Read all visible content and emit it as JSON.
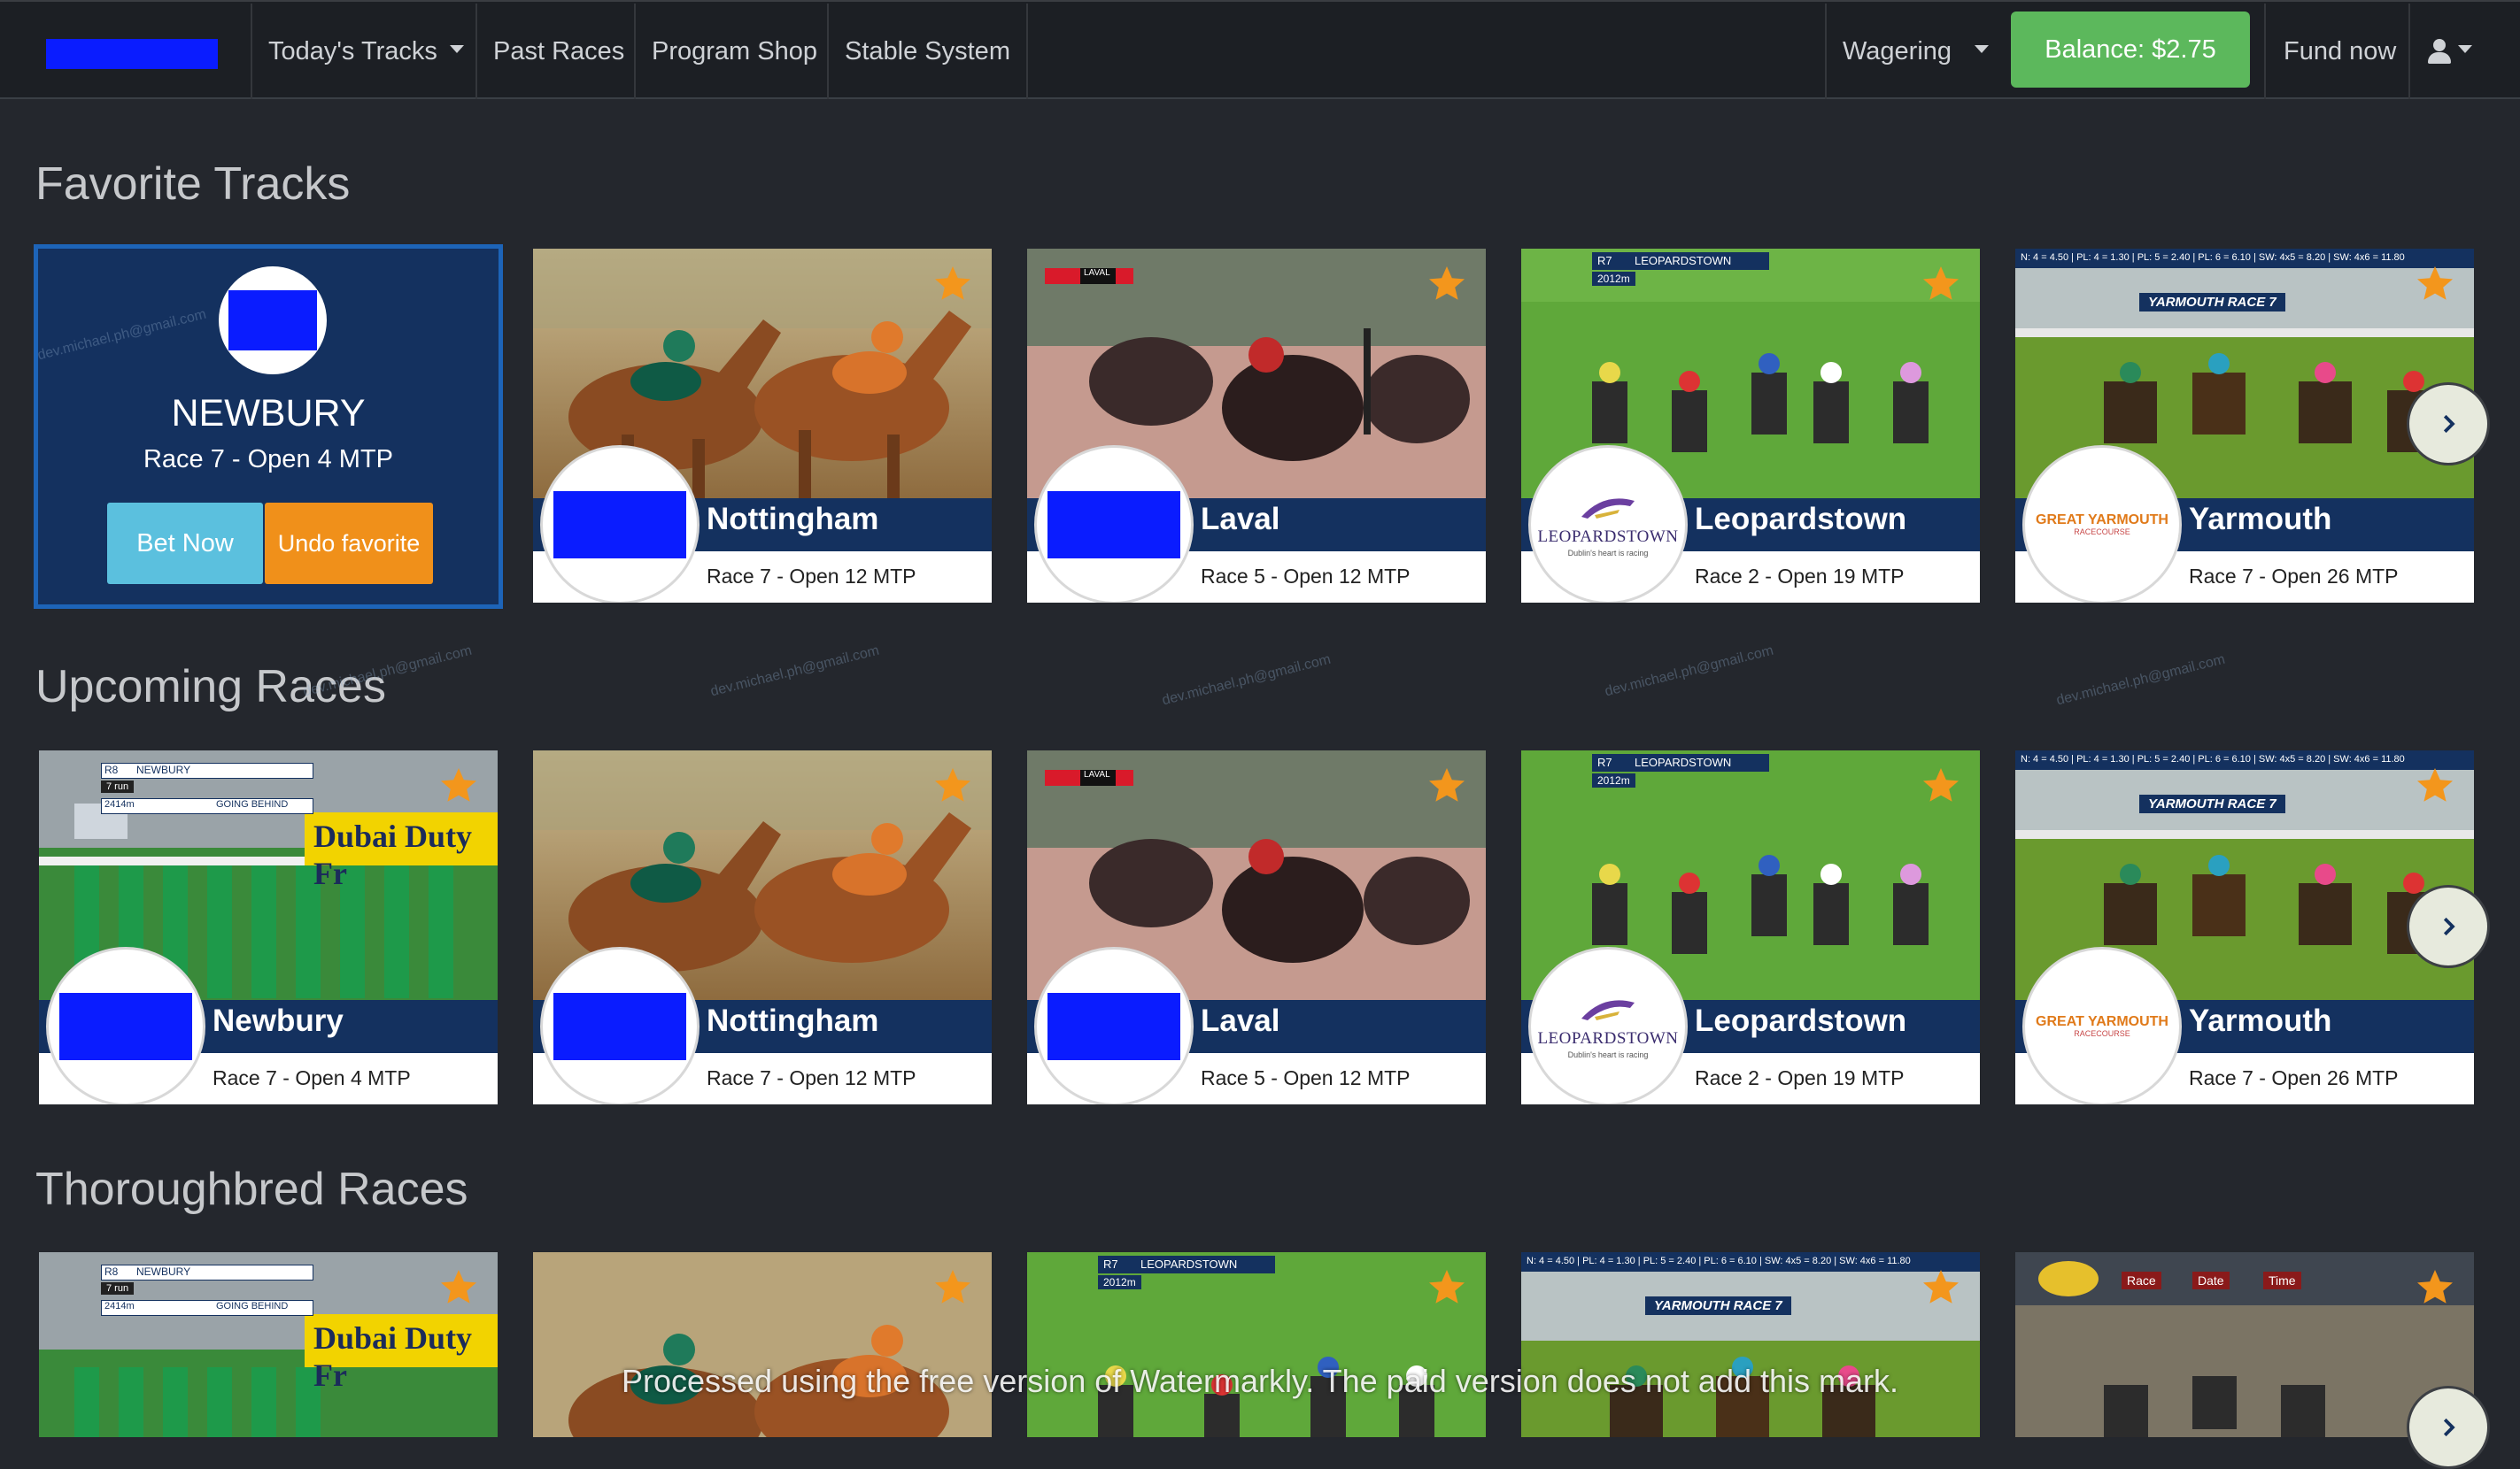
{
  "nav": {
    "items": [
      {
        "label": "Today's Tracks",
        "dropdown": true
      },
      {
        "label": "Past Races"
      },
      {
        "label": "Program Shop"
      },
      {
        "label": "Stable System"
      }
    ],
    "wagering_label": "Wagering",
    "balance_label": "Balance: $2.75",
    "fund_label": "Fund now"
  },
  "favorite_tracks": {
    "title": "Favorite Tracks",
    "featured": {
      "name": "NEWBURY",
      "race": "Race 7  - Open   4 MTP",
      "bet_label": "Bet Now",
      "undo_label": "Undo favorite"
    },
    "cards": [
      {
        "name": "Nottingham",
        "race": "Race 7 - Open 12 MTP",
        "image": "dirt-gallop",
        "logo": "blue"
      },
      {
        "name": "Laval",
        "race": "Race 5 - Open 12 MTP",
        "image": "harness",
        "logo": "blue"
      },
      {
        "name": "Leopardstown",
        "race": "Race 2 - Open 19 MTP",
        "image": "turf-field",
        "logo": "leopardstown",
        "overlay_left": "R7",
        "overlay_right": "LEOPARDSTOWN",
        "overlay_sub": "2012m"
      },
      {
        "name": "Yarmouth",
        "race": "Race 7 - Open 26 MTP",
        "image": "turf-race",
        "logo": "yarmouth",
        "overlay_top": "N: 4 = 4.50 | PL: 4 = 1.30 | PL: 5 = 2.40 | PL: 6 = 6.10 | SW: 4x5 = 8.20 | SW: 4x6 = 11.80",
        "overlay_title": "YARMOUTH RACE 7"
      }
    ]
  },
  "upcoming_races": {
    "title": "Upcoming Races",
    "cards": [
      {
        "name": "Newbury",
        "race": "Race 7 - Open 4 MTP",
        "image": "starting-gate",
        "logo": "blue",
        "overlay_left": "R8",
        "overlay_right": "NEWBURY",
        "overlay_runners": "7 run",
        "overlay_dist": "2414m",
        "overlay_going": "GOING BEHIND",
        "sponsor": "Dubai Duty Fr"
      },
      {
        "name": "Nottingham",
        "race": "Race 7 - Open 12 MTP",
        "image": "dirt-gallop",
        "logo": "blue"
      },
      {
        "name": "Laval",
        "race": "Race 5 - Open 12 MTP",
        "image": "harness",
        "logo": "blue"
      },
      {
        "name": "Leopardstown",
        "race": "Race 2 - Open 19 MTP",
        "image": "turf-field",
        "logo": "leopardstown",
        "overlay_left": "R7",
        "overlay_right": "LEOPARDSTOWN",
        "overlay_sub": "2012m"
      },
      {
        "name": "Yarmouth",
        "race": "Race 7 - Open 26 MTP",
        "image": "turf-race",
        "logo": "yarmouth",
        "overlay_top": "N: 4 = 4.50 | PL: 4 = 1.30 | PL: 5 = 2.40 | PL: 6 = 6.10 | SW: 4x5 = 8.20 | SW: 4x6 = 11.80",
        "overlay_title": "YARMOUTH RACE 7"
      }
    ]
  },
  "thoroughbred_races": {
    "title": "Thoroughbred Races",
    "cards": [
      {
        "image": "starting-gate"
      },
      {
        "image": "dirt-gallop"
      },
      {
        "image": "turf-field"
      },
      {
        "image": "turf-race"
      },
      {
        "image": "dirt-track",
        "overlay_labels": [
          "Race",
          "Date",
          "Time"
        ]
      }
    ]
  },
  "logos": {
    "leopardstown_name": "LEOPARDSTOWN",
    "leopardstown_tagline": "Dublin's heart is racing",
    "yarmouth_name": "GREAT YARMOUTH",
    "yarmouth_sub": "RACECOURSE"
  },
  "watermark_text": "dev.michael.ph@gmail.com",
  "watermark_note": "Processed using the free version of Watermarkly. The paid version does not add this mark.",
  "colors": {
    "background": "#24272d",
    "nav": "#1c1f24",
    "band": "#14315f",
    "balance": "#5cb85c",
    "bet": "#5bc0de",
    "undo": "#f0901a",
    "star": "#f3961c"
  }
}
